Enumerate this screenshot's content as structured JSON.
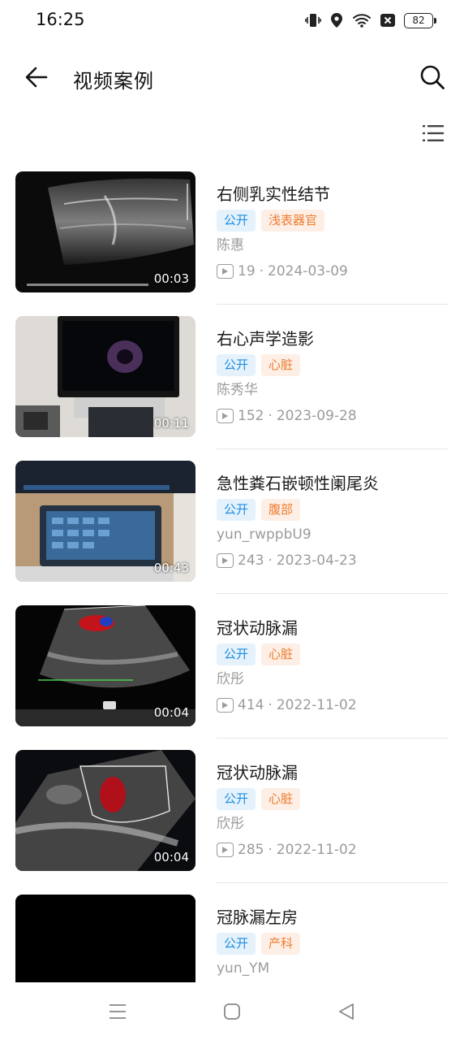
{
  "status": {
    "time": "16:25",
    "battery": "82"
  },
  "header": {
    "title": "视频案例"
  },
  "icons": {
    "back": "arrow-left-icon",
    "search": "search-icon",
    "list": "list-view-icon",
    "play": "play-count-icon"
  },
  "videos": [
    {
      "title": "右侧乳实性结节",
      "duration": "00:03",
      "tags": [
        "公开",
        "浅表器官"
      ],
      "author": "陈惠",
      "views": "19",
      "separator": "·",
      "date": "2024-03-09"
    },
    {
      "title": "右心声学造影",
      "duration": "00:11",
      "tags": [
        "公开",
        "心脏"
      ],
      "author": "陈秀华",
      "views": "152",
      "separator": "·",
      "date": "2023-09-28"
    },
    {
      "title": "急性粪石嵌顿性阑尾炎",
      "duration": "00:43",
      "tags": [
        "公开",
        "腹部"
      ],
      "author": "yun_rwppbU9",
      "views": "243",
      "separator": "·",
      "date": "2023-04-23"
    },
    {
      "title": "冠状动脉漏",
      "duration": "00:04",
      "tags": [
        "公开",
        "心脏"
      ],
      "author": "欣彤",
      "views": "414",
      "separator": "·",
      "date": "2022-11-02"
    },
    {
      "title": "冠状动脉漏",
      "duration": "00:04",
      "tags": [
        "公开",
        "心脏"
      ],
      "author": "欣彤",
      "views": "285",
      "separator": "·",
      "date": "2022-11-02"
    },
    {
      "title": "冠脉漏左房",
      "duration": "",
      "tags": [
        "公开",
        "产科"
      ],
      "author": "yun_YM",
      "views": "",
      "separator": "",
      "date": ""
    }
  ],
  "colors": {
    "tag_public_bg": "#e5f2fc",
    "tag_public_text": "#1e8ee0",
    "tag_category_bg": "#fdefe6",
    "tag_category_text": "#ee7d32"
  }
}
